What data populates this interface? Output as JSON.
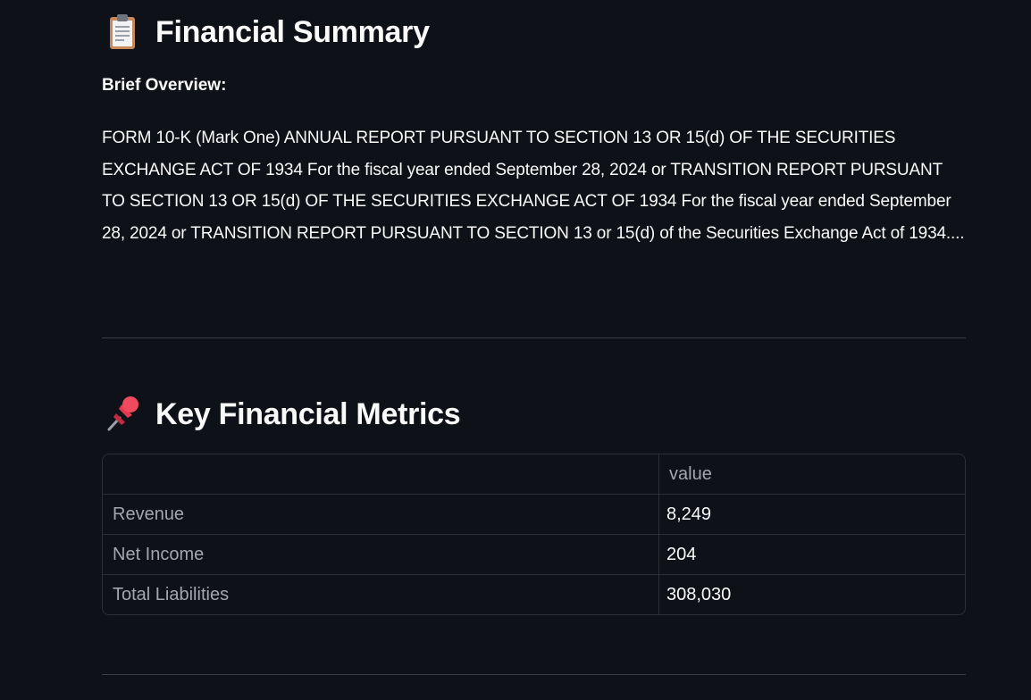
{
  "summary": {
    "title": "Financial Summary",
    "icon": "clipboard-icon",
    "overview_label": "Brief Overview:",
    "overview_text": "FORM 10-K (Mark One) ANNUAL REPORT PURSUANT TO SECTION 13 OR 15(d) OF THE SECURITIES EXCHANGE ACT OF 1934 For the fiscal year ended September 28, 2024 or TRANSITION REPORT PURSUANT TO SECTION 13 OR 15(d) OF THE SECURITIES EXCHANGE ACT OF 1934 For the fiscal year ended September 28, 2024 or TRANSITION REPORT PURSUANT TO SECTION 13 or 15(d) of the Securities Exchange Act of 1934...."
  },
  "metrics": {
    "title": "Key Financial Metrics",
    "icon": "pushpin-icon",
    "table": {
      "columns": [
        "",
        "value"
      ],
      "rows": [
        {
          "label": "Revenue",
          "value": "8,249"
        },
        {
          "label": "Net Income",
          "value": "204"
        },
        {
          "label": "Total Liabilities",
          "value": "308,030"
        }
      ]
    }
  },
  "colors": {
    "background": "#0e1117",
    "text": "#fafafa",
    "muted": "#a3a6ad",
    "border": "#2c2f36"
  }
}
